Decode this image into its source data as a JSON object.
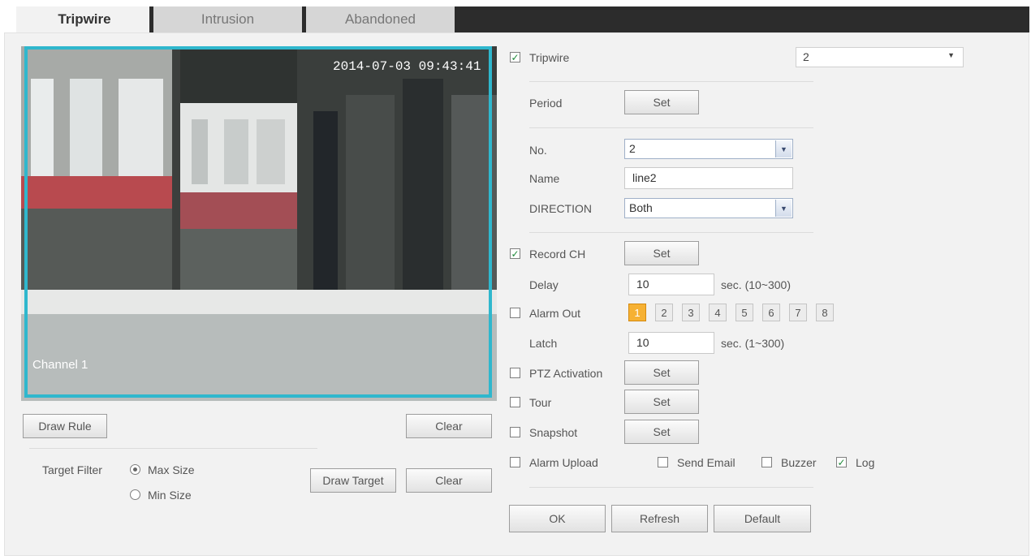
{
  "tabs": [
    {
      "label": "Tripwire",
      "active": true
    },
    {
      "label": "Intrusion",
      "active": false
    },
    {
      "label": "Abandoned",
      "active": false
    }
  ],
  "video": {
    "timestamp": "2014-07-03 09:43:41",
    "channel_label": "Channel 1",
    "rule_color": "#2fb7cd"
  },
  "left_controls": {
    "draw_rule": "Draw Rule",
    "clear_rule": "Clear",
    "target_filter_label": "Target Filter",
    "max_size": "Max Size",
    "min_size": "Min Size",
    "selected_size": "Max Size",
    "draw_target": "Draw Target",
    "clear_target": "Clear"
  },
  "settings": {
    "tripwire": {
      "label": "Tripwire",
      "checked": true,
      "value": "2"
    },
    "period": {
      "label": "Period",
      "button": "Set"
    },
    "no": {
      "label": "No.",
      "value": "2"
    },
    "name": {
      "label": "Name",
      "value": "line2"
    },
    "direction": {
      "label": "DIRECTION",
      "value": "Both"
    },
    "record_ch": {
      "label": "Record CH",
      "checked": true,
      "button": "Set"
    },
    "delay": {
      "label": "Delay",
      "value": "10",
      "unit": "sec. (10~300)"
    },
    "alarm_out": {
      "label": "Alarm Out",
      "checked": false,
      "channels": [
        "1",
        "2",
        "3",
        "4",
        "5",
        "6",
        "7",
        "8"
      ],
      "active_channel": "1"
    },
    "latch": {
      "label": "Latch",
      "value": "10",
      "unit": "sec. (1~300)"
    },
    "ptz_activation": {
      "label": "PTZ Activation",
      "checked": false,
      "button": "Set"
    },
    "tour": {
      "label": "Tour",
      "checked": false,
      "button": "Set"
    },
    "snapshot": {
      "label": "Snapshot",
      "checked": false,
      "button": "Set"
    },
    "alarm_upload": {
      "label": "Alarm Upload",
      "checked": false
    },
    "send_email": {
      "label": "Send Email",
      "checked": false
    },
    "buzzer": {
      "label": "Buzzer",
      "checked": false
    },
    "log": {
      "label": "Log",
      "checked": true
    }
  },
  "footer": {
    "ok": "OK",
    "refresh": "Refresh",
    "default": "Default"
  },
  "icons": {
    "check": "check-mark-icon",
    "dropdown": "chevron-down-icon",
    "radio": "radio-dot-icon"
  }
}
